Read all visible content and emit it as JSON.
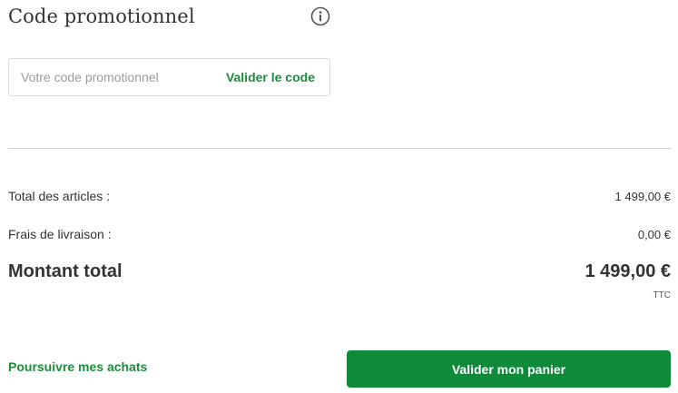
{
  "promo": {
    "title": "Code promotionnel",
    "info_icon": "info-circle-icon",
    "input_placeholder": "Votre code promotionnel",
    "input_value": "",
    "submit_label": "Valider le code"
  },
  "summary": {
    "items_label": "Total des articles :",
    "items_value": "1 499,00 €",
    "shipping_label": "Frais de livraison :",
    "shipping_value": "0,00 €",
    "total_label": "Montant total",
    "total_value": "1 499,00 €",
    "tax_note": "TTC"
  },
  "actions": {
    "continue_label": "Poursuivre mes achats",
    "checkout_label": "Valider mon panier"
  },
  "colors": {
    "accent_green": "#0f8a3a",
    "link_green": "#1e8a3c",
    "text": "#333333",
    "border": "#dcdcdc"
  }
}
